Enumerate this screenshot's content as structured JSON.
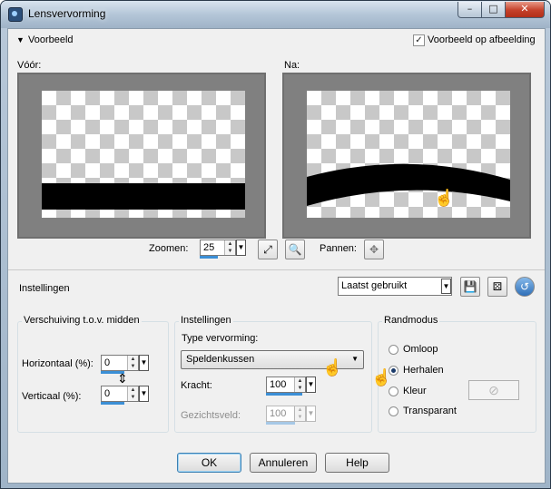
{
  "window": {
    "title": "Lensvervorming",
    "minimize_icon": "minimize-icon",
    "maximize_icon": "maximize-icon",
    "close_icon": "close-icon"
  },
  "preview_section": {
    "title": "Voorbeeld",
    "preview_on_image_label": "Voorbeeld op afbeelding",
    "preview_on_image_checked": true,
    "before_label": "Vóór:",
    "after_label": "Na:",
    "zoom_label": "Zoomen:",
    "zoom_value": "25",
    "pan_label": "Pannen:"
  },
  "settings_bar": {
    "label": "Instellingen",
    "preset_value": "Laatst gebruikt"
  },
  "offset_group": {
    "title": "Verschuiving t.o.v. midden",
    "horizontal_label": "Horizontaal (%):",
    "horizontal_value": "0",
    "vertical_label": "Verticaal (%):",
    "vertical_value": "0"
  },
  "settings_group": {
    "title": "Instellingen",
    "type_label": "Type vervorming:",
    "type_value": "Speldenkussen",
    "strength_label": "Kracht:",
    "strength_value": "100",
    "fov_label": "Gezichtsveld:",
    "fov_value": "100"
  },
  "edge_group": {
    "title": "Randmodus",
    "options": [
      "Omloop",
      "Herhalen",
      "Kleur",
      "Transparant"
    ],
    "selected": "Herhalen"
  },
  "buttons": {
    "ok": "OK",
    "cancel": "Annuleren",
    "help": "Help"
  },
  "colors": {
    "accent": "#3b8fd6",
    "preview_bg": "#808080",
    "close_red": "#c4402a"
  }
}
